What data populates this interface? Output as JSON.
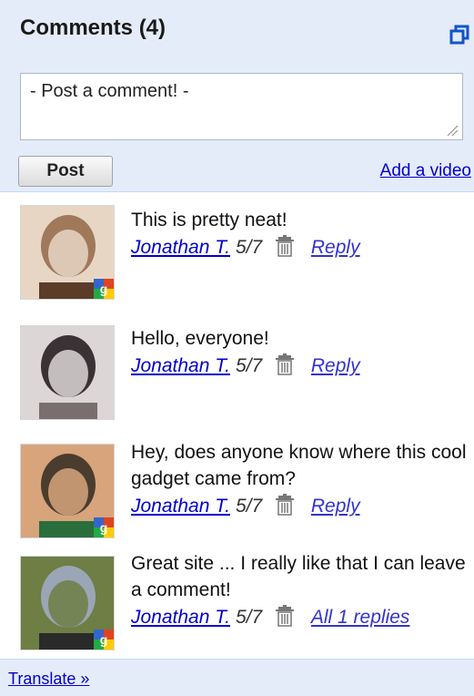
{
  "header": {
    "title": "Comments (4)",
    "comment_placeholder": "- Post a comment! -",
    "post_label": "Post",
    "add_video_label": "Add a video"
  },
  "comments": [
    {
      "text": "This is pretty neat!",
      "author": "Jonathan T.",
      "date": "5/7",
      "action": "Reply",
      "avatar_colors": [
        "#a0785a",
        "#e8d6c5",
        "#5a3c28"
      ],
      "badge": "google"
    },
    {
      "text": "Hello, everyone!",
      "author": "Jonathan T.",
      "date": "5/7",
      "action": "Reply",
      "avatar_colors": [
        "#3a3234",
        "#dcd6d6",
        "#7a6e6e"
      ],
      "badge": "none"
    },
    {
      "text": "Hey, does anyone know where this cool gadget came from?",
      "author": "Jonathan T.",
      "date": "5/7",
      "action": "Reply",
      "avatar_colors": [
        "#4a3c2e",
        "#d7a47c",
        "#2a6e3c"
      ],
      "badge": "google"
    },
    {
      "text": "Great site ... I really like that I can leave a comment!",
      "author": "Jonathan T.",
      "date": "5/7",
      "action": "All 1 replies",
      "avatar_colors": [
        "#9aa6b6",
        "#6e7e44",
        "#2a2a2a"
      ],
      "badge": "google"
    }
  ],
  "footer": {
    "translate_label": "Translate »"
  },
  "colors": {
    "panel_bg": "#e5ecf9",
    "link": "#0000cc",
    "icon_blue": "#1155cc"
  }
}
